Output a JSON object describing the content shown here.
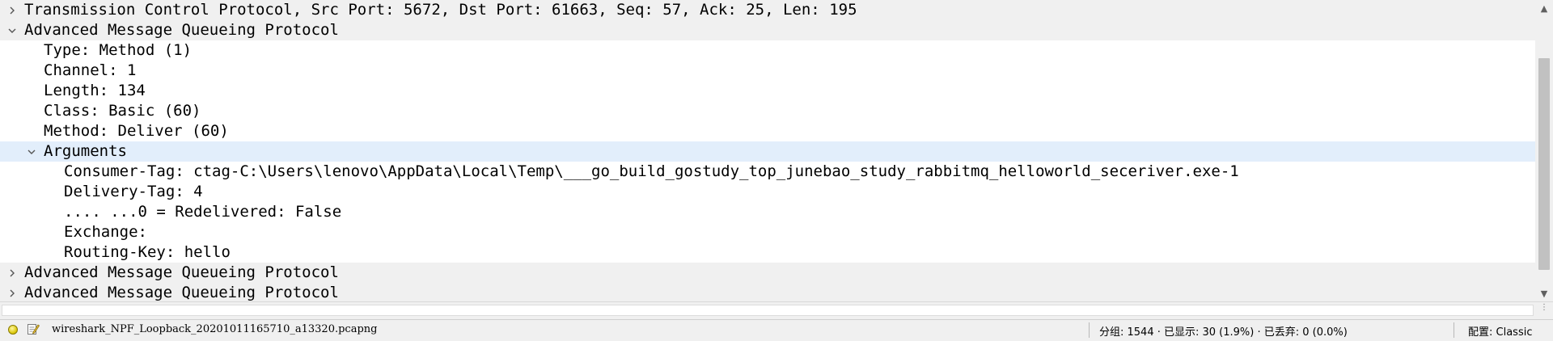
{
  "packet_details": {
    "rows": [
      {
        "text": "Transmission Control Protocol, Src Port: 5672, Dst Port: 61663, Seq: 57, Ack: 25, Len: 195",
        "indent": 0,
        "toggle": "collapsed"
      },
      {
        "text": "Advanced Message Queueing Protocol",
        "indent": 0,
        "toggle": "expanded"
      },
      {
        "text": "Type: Method (1)",
        "indent": 1,
        "toggle": "none"
      },
      {
        "text": "Channel: 1",
        "indent": 1,
        "toggle": "none"
      },
      {
        "text": "Length: 134",
        "indent": 1,
        "toggle": "none"
      },
      {
        "text": "Class: Basic (60)",
        "indent": 1,
        "toggle": "none"
      },
      {
        "text": "Method: Deliver (60)",
        "indent": 1,
        "toggle": "none"
      },
      {
        "text": "Arguments",
        "indent": 1,
        "toggle": "expanded",
        "selected": true
      },
      {
        "text": "Consumer-Tag: ctag-C:\\Users\\lenovo\\AppData\\Local\\Temp\\___go_build_gostudy_top_junebao_study_rabbitmq_helloworld_seceriver.exe-1",
        "indent": 2,
        "toggle": "none"
      },
      {
        "text": "Delivery-Tag: 4",
        "indent": 2,
        "toggle": "none"
      },
      {
        "text": ".... ...0 = Redelivered: False",
        "indent": 2,
        "toggle": "none"
      },
      {
        "text": "Exchange: ",
        "indent": 2,
        "toggle": "none"
      },
      {
        "text": "Routing-Key: hello",
        "indent": 2,
        "toggle": "none"
      },
      {
        "text": "Advanced Message Queueing Protocol",
        "indent": 0,
        "toggle": "collapsed"
      },
      {
        "text": "Advanced Message Queueing Protocol",
        "indent": 0,
        "toggle": "collapsed"
      }
    ]
  },
  "icons": {
    "collapsed": "chevron-right-icon",
    "expanded": "chevron-down-icon",
    "scroll_up": "scroll-up-arrow-icon",
    "scroll_down": "scroll-down-arrow-icon",
    "capture_status": "capture-status-indicator-icon",
    "edit_comment": "edit-comment-icon"
  },
  "statusbar": {
    "file_name": "wireshark_NPF_Loopback_20201011165710_a13320.pcapng",
    "stats": "分组: 1544 · 已显示: 30 (1.9%) · 已丢弃: 0 (0.0%)",
    "profile": "配置: Classic"
  },
  "colors": {
    "header_row_bg": "#f0f0f0",
    "selected_row_bg": "#e2eefb",
    "status_indicator": "#d8c400"
  }
}
